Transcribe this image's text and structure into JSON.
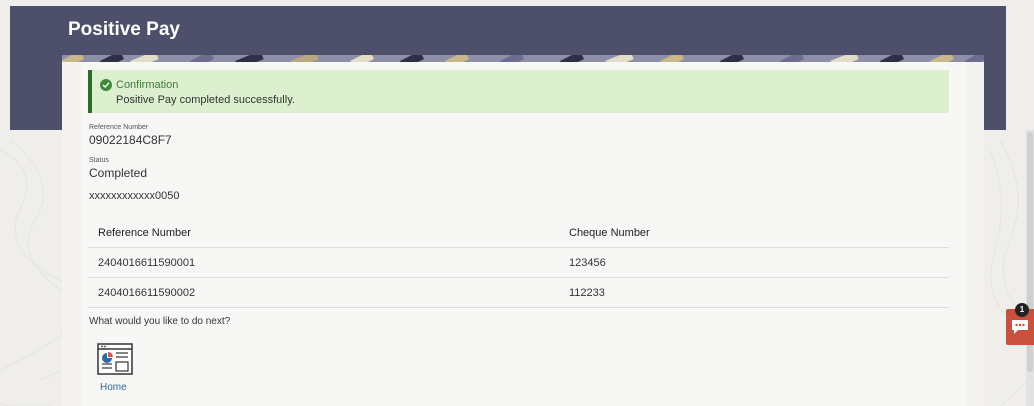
{
  "page": {
    "title": "Positive Pay"
  },
  "confirmation": {
    "title": "Confirmation",
    "message": "Positive Pay completed successfully."
  },
  "details": {
    "reference_label": "Reference Number",
    "reference_value": "09022184C8F7",
    "status_label": "Status",
    "status_value": "Completed",
    "account": "xxxxxxxxxxxx0050"
  },
  "table": {
    "headers": [
      "Reference Number",
      "Cheque Number"
    ],
    "rows": [
      [
        "2404016611590001",
        "123456"
      ],
      [
        "2404016611590002",
        "112233"
      ]
    ]
  },
  "next_steps": {
    "question": "What would you like to do next?",
    "home_label": "Home"
  },
  "chat": {
    "badge_count": "1",
    "icon": "chat-icon"
  },
  "colors": {
    "header": "#4d4f6b",
    "confirm_bg": "#dcefcf",
    "confirm_accent": "#2f6b2a",
    "link": "#2b6aa8",
    "chat": "#c9503c"
  }
}
